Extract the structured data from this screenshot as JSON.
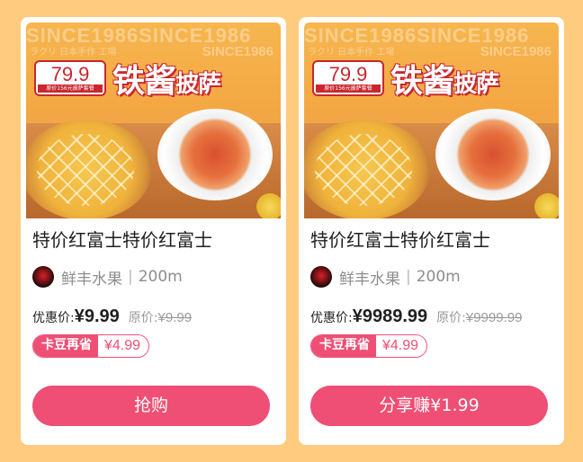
{
  "products": [
    {
      "banner": {
        "since_text": "SINCE1986SINCE1986",
        "since_small": "SINCE1986",
        "since_jp": "ラクリ 日本手作 工場",
        "price": "79.9",
        "price_note": "原价156元披萨套餐",
        "headline_a": "铁酱",
        "headline_b": "披萨"
      },
      "title": "特价红富士特价红富士",
      "shop_name": "鲜丰水果",
      "distance": "200m",
      "discount_label": "优惠价:",
      "discount_price": "¥9.99",
      "original_label": "原价:",
      "original_price": "¥9.99",
      "kadou_label": "卡豆再省",
      "kadou_value": "¥4.99",
      "button_label": "抢购"
    },
    {
      "banner": {
        "since_text": "SINCE1986SINCE1986",
        "since_small": "SINCE1986",
        "since_jp": "ラクリ 日本手作 工場",
        "price": "79.9",
        "price_note": "原价156元披萨套餐",
        "headline_a": "铁酱",
        "headline_b": "披萨"
      },
      "title": "特价红富士特价红富士",
      "shop_name": "鲜丰水果",
      "distance": "200m",
      "discount_label": "优惠价:",
      "discount_price": "¥9989.99",
      "original_label": "原价:",
      "original_price": "¥9999.99",
      "kadou_label": "卡豆再省",
      "kadou_value": "¥4.99",
      "button_label": "分享赚¥1.99"
    }
  ],
  "colors": {
    "background": "#FECB7F",
    "accent": "#EF4F74",
    "brand_red": "#C8272E"
  }
}
